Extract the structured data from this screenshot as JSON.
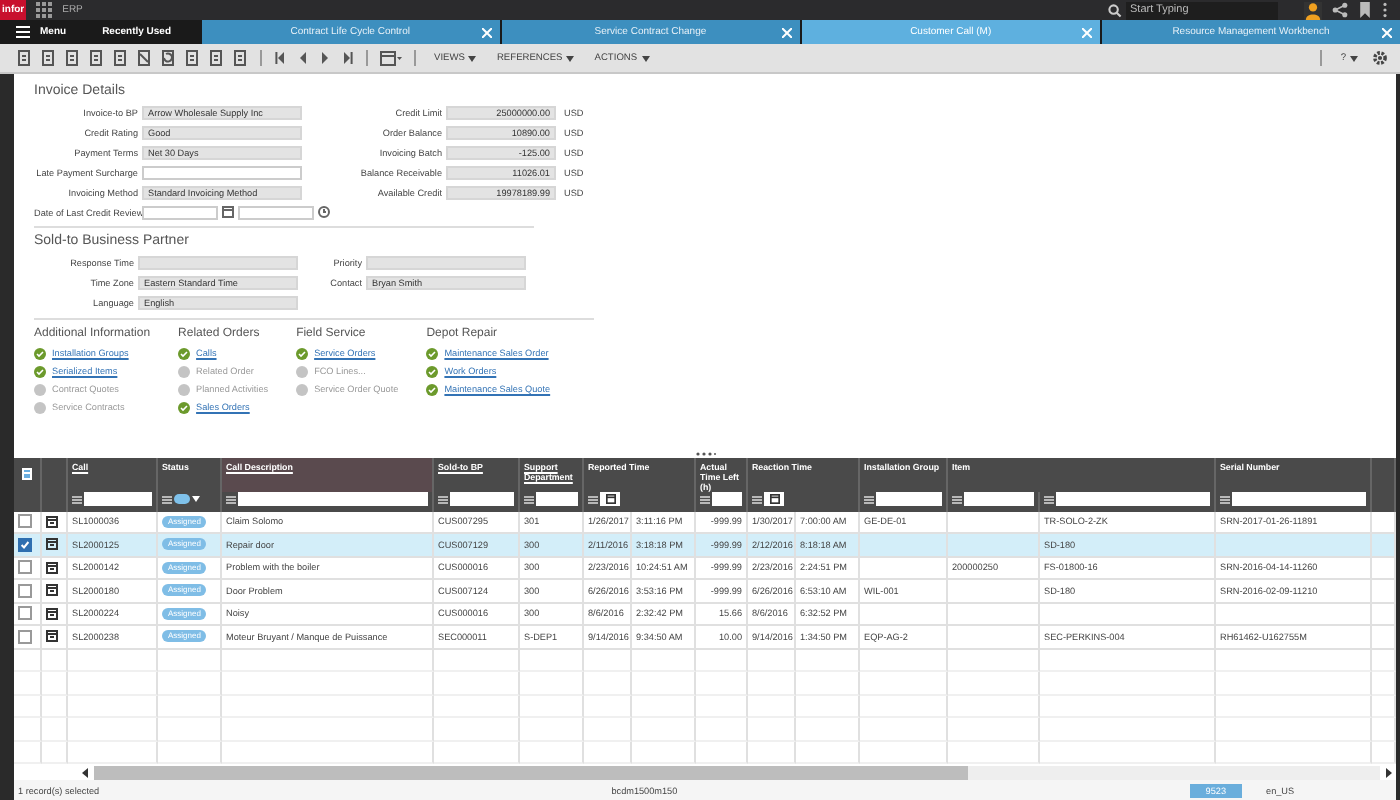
{
  "header": {
    "logo": "infor",
    "app": "ERP",
    "search_placeholder": "Start Typing"
  },
  "nav": {
    "menu": "Menu",
    "recent": "Recently Used"
  },
  "tabs": [
    {
      "label": "Contract Life Cycle Control",
      "selected": false
    },
    {
      "label": "Service Contract Change",
      "selected": false
    },
    {
      "label": "Customer Call (M)",
      "selected": true
    },
    {
      "label": "Resource Management Workbench",
      "selected": false
    }
  ],
  "toolbar": {
    "menus": [
      "VIEWS",
      "REFERENCES",
      "ACTIONS"
    ],
    "help": "?"
  },
  "invoice": {
    "title": "Invoice Details",
    "left": [
      {
        "label": "Invoice-to BP",
        "value": "Arrow Wholesale Supply Inc"
      },
      {
        "label": "Credit Rating",
        "value": "Good"
      },
      {
        "label": "Payment Terms",
        "value": "Net 30 Days"
      },
      {
        "label": "Late Payment Surcharge"
      },
      {
        "label": "Invoicing Method",
        "value": "Standard Invoicing Method"
      }
    ],
    "right": [
      {
        "label": "Credit Limit",
        "value": "25000000.00",
        "unit": "USD"
      },
      {
        "label": "Order Balance",
        "value": "10890.00",
        "unit": "USD"
      },
      {
        "label": "Invoicing Batch",
        "value": "-125.00",
        "unit": "USD"
      },
      {
        "label": "Balance Receivable",
        "value": "11026.01",
        "unit": "USD"
      },
      {
        "label": "Available Credit",
        "value": "19978189.99",
        "unit": "USD"
      }
    ],
    "review_label": "Date of Last Credit Review"
  },
  "sold_to": {
    "title": "Sold-to Business Partner",
    "fields": [
      {
        "label": "Response Time"
      },
      {
        "label": "Priority"
      },
      {
        "label": "Time Zone",
        "value": "Eastern Standard Time"
      },
      {
        "label": "Contact",
        "value": "Bryan Smith"
      },
      {
        "label": "Language",
        "value": "English"
      }
    ]
  },
  "link_groups": [
    {
      "title": "Additional Information",
      "links": [
        {
          "label": "Installation Groups",
          "available": true
        },
        {
          "label": "Serialized Items",
          "available": true
        },
        {
          "label": "Contract Quotes",
          "available": false
        },
        {
          "label": "Service Contracts",
          "available": false
        }
      ]
    },
    {
      "title": "Related Orders",
      "links": [
        {
          "label": "Calls",
          "available": true
        },
        {
          "label": "Related Order",
          "available": false
        },
        {
          "label": "Planned Activities",
          "available": false
        },
        {
          "label": "Sales Orders",
          "available": true
        }
      ]
    },
    {
      "title": "Field Service",
      "links": [
        {
          "label": "Service Orders",
          "available": true
        },
        {
          "label": "FCO Lines...",
          "available": false
        },
        {
          "label": "Service Order Quote",
          "available": false
        }
      ]
    },
    {
      "title": "Depot Repair",
      "links": [
        {
          "label": "Maintenance Sales Order",
          "available": true
        },
        {
          "label": "Work Orders",
          "available": true
        },
        {
          "label": "Maintenance Sales Quote",
          "available": true
        }
      ]
    }
  ],
  "grid": {
    "select_all_partial": true,
    "columns": [
      "Call",
      "Status",
      "Call Description",
      "Sold-to BP",
      "Support Department",
      "Reported Time",
      "Actual Time Left (h)",
      "Reaction Time",
      "Installation Group",
      "Item",
      "Serial Number"
    ],
    "rows": [
      {
        "selected": false,
        "call": "SL1000036",
        "status": "Assigned",
        "description": "Claim Solomo",
        "sold_to": "CUS007295",
        "department": "301",
        "reported_date": "1/26/2017",
        "reported_time": "3:11:16 PM",
        "time_left": "-999.99",
        "reaction_date": "1/30/2017",
        "reaction_time": "7:00:00 AM",
        "installation_group": "GE-DE-01",
        "item_2": "TR-SOLO-2-ZK",
        "serial": "SRN-2017-01-26-11891"
      },
      {
        "selected": true,
        "call": "SL2000125",
        "status": "Assigned",
        "description": "Repair door",
        "sold_to": "CUS007129",
        "department": "300",
        "reported_date": "2/11/2016",
        "reported_time": "3:18:18 PM",
        "time_left": "-999.99",
        "reaction_date": "2/12/2016",
        "reaction_time": "8:18:18 AM",
        "item_2": "SD-180"
      },
      {
        "selected": false,
        "call": "SL2000142",
        "status": "Assigned",
        "description": "Problem with the boiler",
        "sold_to": "CUS000016",
        "department": "300",
        "reported_date": "2/23/2016",
        "reported_time": "10:24:51 AM",
        "time_left": "-999.99",
        "reaction_date": "2/23/2016",
        "reaction_time": "2:24:51 PM",
        "item": "200000250",
        "item_2": "FS-01800-16",
        "serial": "SRN-2016-04-14-11260"
      },
      {
        "selected": false,
        "call": "SL2000180",
        "status": "Assigned",
        "description": "Door Problem",
        "sold_to": "CUS007124",
        "department": "300",
        "reported_date": "6/26/2016",
        "reported_time": "3:53:16 PM",
        "time_left": "-999.99",
        "reaction_date": "6/26/2016",
        "reaction_time": "6:53:10 AM",
        "installation_group": "WIL-001",
        "item_2": "SD-180",
        "serial": "SRN-2016-02-09-11210"
      },
      {
        "selected": false,
        "call": "SL2000224",
        "status": "Assigned",
        "description": "Noisy",
        "sold_to": "CUS000016",
        "department": "300",
        "reported_date": "8/6/2016",
        "reported_time": "2:32:42 PM",
        "time_left": "15.66",
        "reaction_date": "8/6/2016",
        "reaction_time": "6:32:52 PM"
      },
      {
        "selected": false,
        "call": "SL2000238",
        "status": "Assigned",
        "description": "Moteur Bruyant / Manque de Puissance",
        "sold_to": "SEC000011",
        "department": "S-DEP1",
        "reported_date": "9/14/2016",
        "reported_time": "9:34:50 AM",
        "time_left": "10.00",
        "reaction_date": "9/14/2016",
        "reaction_time": "1:34:50 PM",
        "installation_group": "EQP-AG-2",
        "item_2": "SEC-PERKINS-004",
        "serial": "RH61462-U162755M"
      }
    ]
  },
  "status_bar": {
    "selection": "1 record(s) selected",
    "server": "bcdm1500m150",
    "badge": "9523",
    "locale": "en_US"
  }
}
